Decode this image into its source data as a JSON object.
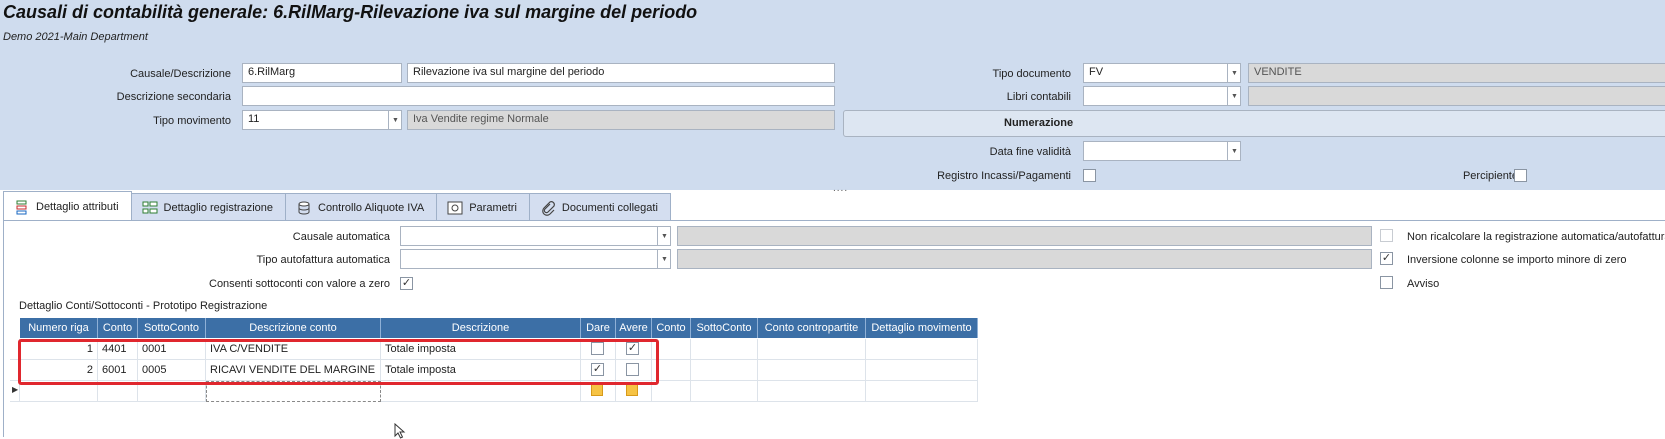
{
  "header": {
    "title": "Causali di contabilità generale: 6.RilMarg-Rilevazione iva sul margine del periodo",
    "subtitle": "Demo 2021-Main Department"
  },
  "form": {
    "causale_label": "Causale/Descrizione",
    "causale_code": "6.RilMarg",
    "causale_desc": "Rilevazione iva sul margine del periodo",
    "desc_sec_label": "Descrizione secondaria",
    "desc_sec_value": "",
    "tipo_mov_label": "Tipo movimento",
    "tipo_mov_code": "11",
    "tipo_mov_desc": "Iva Vendite regime Normale",
    "tipo_doc_label": "Tipo documento",
    "tipo_doc_code": "FV",
    "tipo_doc_desc": "VENDITE",
    "libri_label": "Libri contabili",
    "libri_value": "",
    "numerazione_label": "Numerazione",
    "data_fine_label": "Data fine validità",
    "data_fine_value": "",
    "registro_label": "Registro Incassi/Pagamenti",
    "percipiente_label": "Percipiente",
    "splitter_glyph": "....",
    "dropdown_glyph": "▼"
  },
  "tabs": [
    {
      "label": "Dettaglio attributi",
      "icon": "attributes-icon",
      "active": true
    },
    {
      "label": "Dettaglio registrazione",
      "icon": "grid-icon",
      "active": false
    },
    {
      "label": "Controllo Aliquote IVA",
      "icon": "coins-icon",
      "active": false
    },
    {
      "label": "Parametri",
      "icon": "parameters-icon",
      "active": false
    },
    {
      "label": "Documenti collegati",
      "icon": "paperclip-icon",
      "active": false
    }
  ],
  "attributes": {
    "causale_auto_label": "Causale automatica",
    "causale_auto_value": "",
    "tipo_autof_label": "Tipo autofattura automatica",
    "tipo_autof_value": "",
    "consenti_label": "Consenti sottoconti con valore a zero",
    "non_ricalc_label": "Non ricalcolare la registrazione automatica/autofattura",
    "inversione_label": "Inversione colonne se importo minore di zero",
    "avviso_label": "Avviso",
    "check_glyph": "✓"
  },
  "grid": {
    "caption": "Dettaglio Conti/Sottoconti - Prototipo Registrazione",
    "columns": [
      "Numero riga",
      "Conto",
      "SottoConto",
      "Descrizione conto",
      "Descrizione",
      "Dare",
      "Avere",
      "Conto",
      "SottoConto",
      "Conto contropartite",
      "Dettaglio movimento"
    ],
    "rows": [
      {
        "riga": "1",
        "conto": "4401",
        "sottoconto": "0001",
        "desc_conto": "IVA C/VENDITE",
        "descrizione": "Totale imposta",
        "dare": false,
        "avere": true
      },
      {
        "riga": "2",
        "conto": "6001",
        "sottoconto": "0005",
        "desc_conto": "RICAVI VENDITE DEL MARGINE",
        "descrizione": "Totale imposta",
        "dare": true,
        "avere": false
      }
    ],
    "new_row_marker": "▶"
  },
  "colors": {
    "header_bg": "#cfdcee",
    "grid_header": "#3c6fa6",
    "highlight": "#e0272e"
  }
}
